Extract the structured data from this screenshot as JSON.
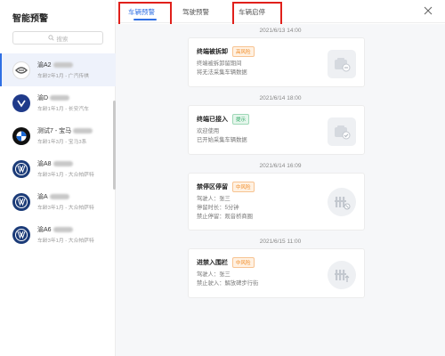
{
  "sidebar": {
    "title": "智能预警",
    "search_placeholder": "搜索",
    "vehicles": [
      {
        "name": "渝A2",
        "sub": "车龄2年1月 - 广汽传祺",
        "logo": "gac-logo"
      },
      {
        "name": "渝D",
        "sub": "车龄1年1月 - 长安汽车",
        "logo": "changan-logo"
      },
      {
        "name": "测试7 - 宝马",
        "sub": "车龄1年3月 - 宝马3系",
        "logo": "bmw-logo"
      },
      {
        "name": "渝A8",
        "sub": "车龄3年1月 - 大众帕萨特",
        "logo": "vw-logo"
      },
      {
        "name": "渝A",
        "sub": "车龄3年1月 - 大众帕萨特",
        "logo": "vw-logo"
      },
      {
        "name": "渝A6",
        "sub": "车龄3年1月 - 大众帕萨特",
        "logo": "vw-logo"
      }
    ]
  },
  "tabs": [
    {
      "label": "车辆预警",
      "active": true
    },
    {
      "label": "驾驶预警",
      "active": false
    },
    {
      "label": "车辆启停",
      "active": false
    }
  ],
  "feed": [
    {
      "time": "2021/6/13  14:00",
      "title": "终端被拆卸",
      "badge": "高风险",
      "badge_kind": "orange",
      "lines": [
        "终端被拆卸留期间",
        "将无法采集车辆数据"
      ],
      "icon": "device-remove-icon"
    },
    {
      "time": "2021/6/14  18:00",
      "title": "终端已接入",
      "badge": "提示",
      "badge_kind": "green",
      "lines": [
        "欢迎使用",
        "已开始采集车辆数据"
      ],
      "icon": "device-connected-icon"
    },
    {
      "time": "2021/6/14  16:09",
      "title": "禁停区停留",
      "badge": "中风险",
      "badge_kind": "orange",
      "lines": [
        "驾驶人：张三",
        "停留时长：5分钟",
        "禁止停留：观音桥商圈"
      ],
      "icon": "no-parking-icon"
    },
    {
      "time": "2021/6/15  11:00",
      "title": "进禁入围栏",
      "badge": "中风险",
      "badge_kind": "orange",
      "lines": [
        "驾驶人：张三",
        "禁止驶入：解放碑步行街"
      ],
      "icon": "fence-enter-icon"
    }
  ],
  "colors": {
    "accent": "#2f6fe4",
    "highlight_box": "#e0201b",
    "risk_orange": "#f08a24",
    "tip_green": "#28a55f"
  }
}
